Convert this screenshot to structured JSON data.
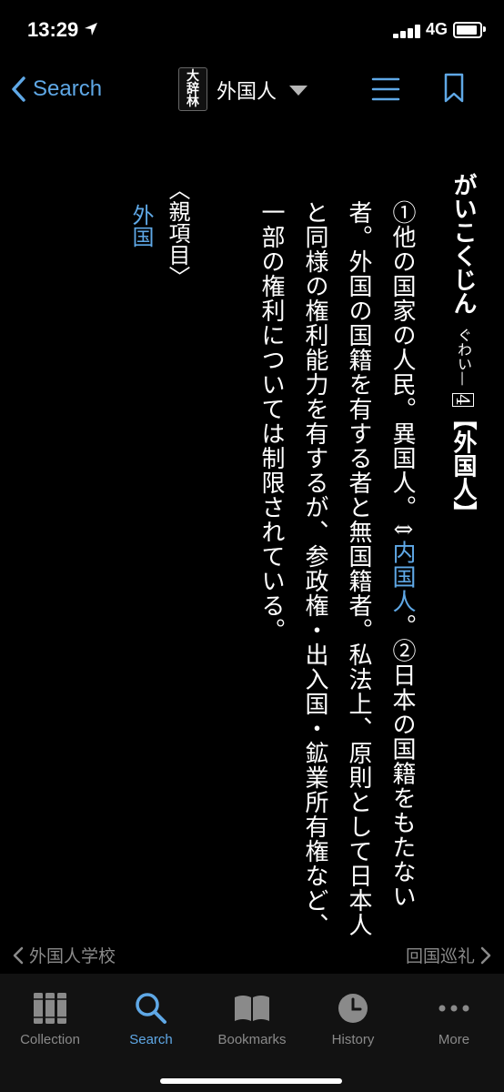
{
  "status_bar": {
    "time": "13:29",
    "network": "4G"
  },
  "nav": {
    "back_label": "Search",
    "dictionary_logo": [
      "大",
      "辞",
      "林"
    ],
    "entry_title": "外国人"
  },
  "entry": {
    "headword": "がいこくじん",
    "reading": "ぐわい—",
    "accent": "4",
    "kanji": "【外国人】",
    "sense1_text": "①他の国家の人民。異国人。⇕",
    "sense1_link": "内国人",
    "sense1_end": "。",
    "sense2_text": "②日本の国籍をもたない者。外国の国籍を有する者と無国籍者。私法上、原則として日本人と同様の権利能力を有するが、参政権・出入国・鉱業所有権など、一部の権利については制限されている。",
    "parent_label": "〈親項目〉",
    "parent_link": "外国"
  },
  "pager": {
    "prev": "外国人学校",
    "next": "回国巡礼"
  },
  "tabs": [
    {
      "label": "Collection",
      "icon": "collection-icon",
      "active": false
    },
    {
      "label": "Search",
      "icon": "search-icon",
      "active": true
    },
    {
      "label": "Bookmarks",
      "icon": "book-icon",
      "active": false
    },
    {
      "label": "History",
      "icon": "clock-icon",
      "active": false
    },
    {
      "label": "More",
      "icon": "more-icon",
      "active": false
    }
  ],
  "colors": {
    "accent": "#5fa8e6",
    "background": "#000000",
    "tab_bar": "#121212",
    "inactive": "#8a8a8a"
  }
}
